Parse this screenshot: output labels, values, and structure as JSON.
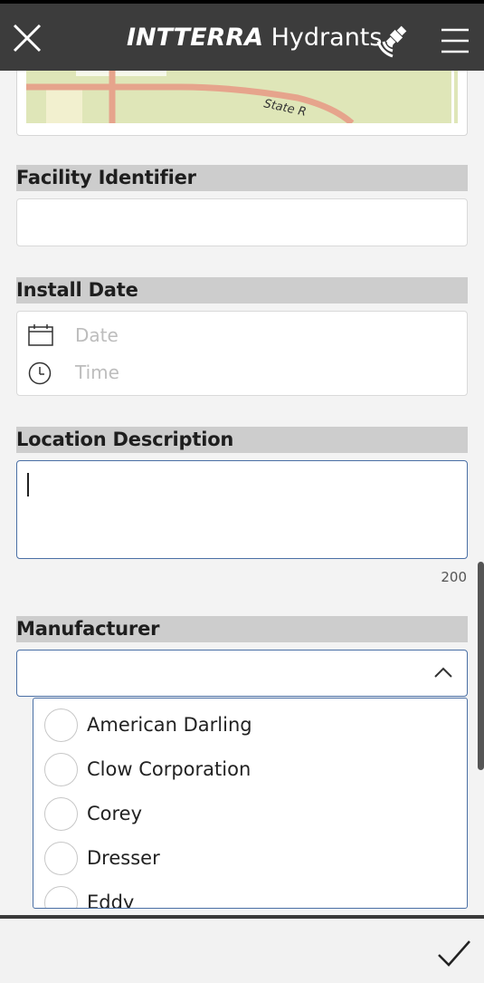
{
  "header": {
    "brand": "INTTERRA",
    "app": "Hydrants"
  },
  "map": {
    "road_label": "State R"
  },
  "form": {
    "facility_identifier": {
      "label": "Facility Identifier",
      "value": ""
    },
    "install_date": {
      "label": "Install Date",
      "date_placeholder": "Date",
      "time_placeholder": "Time"
    },
    "location_description": {
      "label": "Location Description",
      "value": "",
      "char_limit": "200"
    },
    "manufacturer": {
      "label": "Manufacturer",
      "value": "",
      "options": [
        {
          "label": "American Darling"
        },
        {
          "label": "Clow Corporation"
        },
        {
          "label": "Corey"
        },
        {
          "label": "Dresser"
        },
        {
          "label": "Eddy"
        }
      ]
    }
  },
  "icons": {
    "close": "close-icon",
    "gps": "satellite-gps-icon",
    "menu": "hamburger-menu-icon",
    "calendar": "calendar-icon",
    "clock": "clock-icon",
    "chevron": "chevron-up-icon",
    "submit": "checkmark-icon"
  },
  "colors": {
    "header_bg": "#3c3c3c",
    "label_bar": "#cdcdcd",
    "focus_border": "#4a6fa5",
    "map_road": "#e6a48c",
    "map_land": "#dfe6b8"
  }
}
